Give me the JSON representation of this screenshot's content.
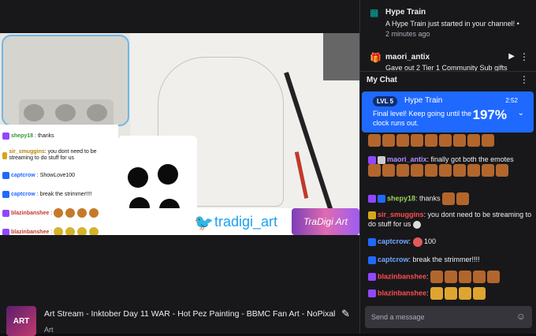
{
  "video": {
    "twitter_handle": "tradigi_art",
    "logo_text": "TraDigi Art",
    "overlay_chat": [
      {
        "user": "shepy18",
        "text": "thanks",
        "color": "#2f9a2f"
      },
      {
        "user": "sir_smuggins",
        "text": "you dont need to be streaming to do stuff for us",
        "color": "#b8860b"
      },
      {
        "user": "captcrow",
        "text": "ShowLove100",
        "color": "#1f69ff"
      },
      {
        "user": "captcrow",
        "text": "break the strimmer!!!!",
        "color": "#1f69ff"
      },
      {
        "user": "blazinbanshee",
        "text": "",
        "color": "#c0392b"
      },
      {
        "user": "blazinbanshee",
        "text": "",
        "color": "#c0392b"
      }
    ]
  },
  "stream": {
    "title": "Art Stream - Inktober Day 11 WAR - Hot Pez Painting - BBMC Fan Art - NoPixal",
    "category": "Art",
    "avatar_text": "ART"
  },
  "notifications": {
    "hype_train": {
      "title": "Hype Train",
      "text": "A Hype Train just started in your channel!",
      "time": "2 minutes ago"
    },
    "community_gift": {
      "user": "maori_antix",
      "text": "Gave out 2 Tier 1 Community Sub gifts"
    }
  },
  "chat": {
    "header": "My Chat",
    "hype": {
      "level": "LVL 5",
      "title": "Hype Train",
      "timer": "2:52",
      "text": "Final level! Keep going until the clock runs out.",
      "percent": "197%"
    },
    "messages": [
      {
        "user": "maori_antix",
        "text": "finally got both the emotes",
        "color": "#b58cff"
      },
      {
        "user": "shepy18",
        "text": "thanks",
        "color": "#9dd25a"
      },
      {
        "user": "sir_smuggins",
        "text": "you dont need to be streaming to do stuff for us",
        "color": "#ff4d4d"
      },
      {
        "user": "captcrow",
        "text": "100",
        "color": "#6fa8ff"
      },
      {
        "user": "captcrow",
        "text": "break the strimmer!!!!",
        "color": "#6fa8ff"
      },
      {
        "user": "blazinbanshee",
        "text": "",
        "color": "#ff4d4d"
      },
      {
        "user": "blazinbanshee",
        "text": "",
        "color": "#ff4d4d"
      }
    ],
    "send_placeholder": "Send a message"
  }
}
